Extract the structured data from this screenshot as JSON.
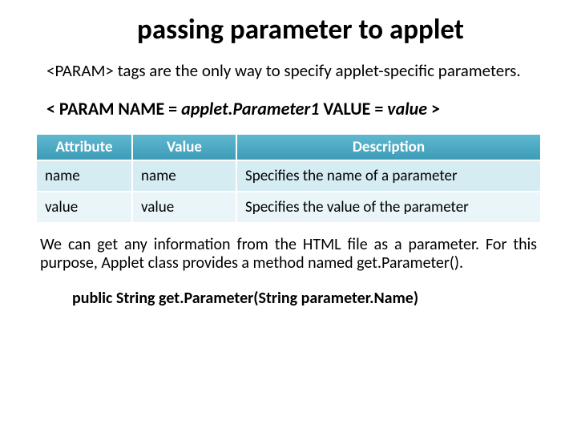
{
  "title": "passing parameter to applet",
  "intro": "<PARAM> tags are the only way to specify applet-specific parameters.",
  "syntax": {
    "pre": "< PARAM NAME = ",
    "p1": "applet.Parameter1",
    "mid": "  VALUE = ",
    "p2": "value",
    "post": " >"
  },
  "table": {
    "headers": {
      "c0": "Attribute",
      "c1": "Value",
      "c2": "Description"
    },
    "rows": [
      {
        "c0": "name",
        "c1": "name",
        "c2": "Specifies the name of a parameter"
      },
      {
        "c0": "value",
        "c1": "value",
        "c2": "Specifies the value of the parameter"
      }
    ]
  },
  "paragraph": "We can get any information from the HTML file as a parameter. For this purpose, Applet class provides a method named get.Parameter().",
  "signature": "public String get.Parameter(String  parameter.Name)"
}
